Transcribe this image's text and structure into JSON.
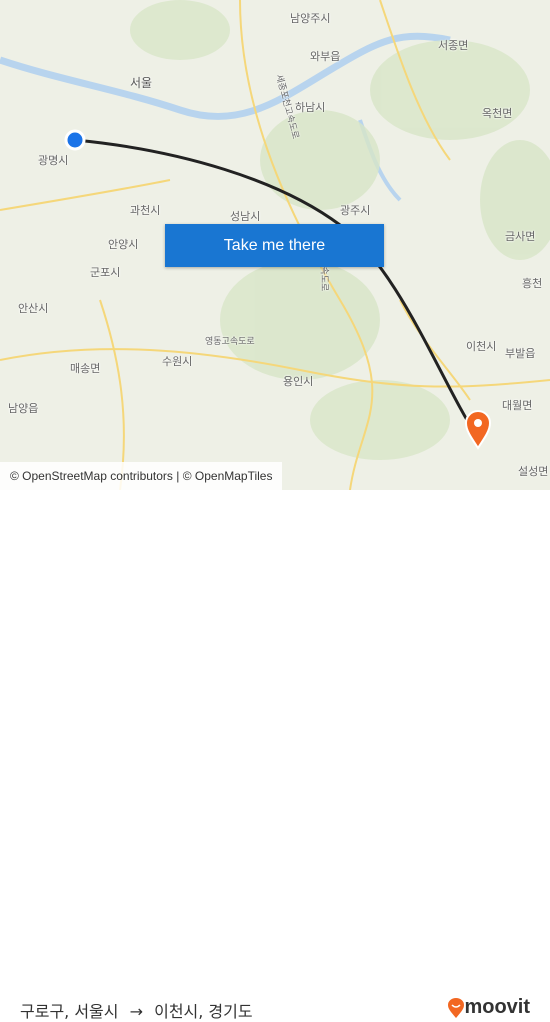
{
  "map": {
    "labels": [
      "남양주시",
      "와부읍",
      "서종면",
      "서울",
      "하남시",
      "옥천면",
      "광명시",
      "과천시",
      "성남시",
      "광주시",
      "금사면",
      "안양시",
      "군포시",
      "안산시",
      "흥천",
      "수원시",
      "부발읍",
      "매송면",
      "용인시",
      "대월면",
      "남양읍",
      "이천시",
      "설성면",
      "영동고속도로",
      "세종포천고속도로",
      "중부고속도로"
    ],
    "route_color": "#222222",
    "origin_color": "#1a73e8",
    "destination_color": "#f26722"
  },
  "cta": {
    "label": "Take me there"
  },
  "attribution": "© OpenStreetMap contributors | © OpenMapTiles",
  "footer": {
    "origin": "구로구, 서울시",
    "arrow": "→",
    "destination": "이천시, 경기도",
    "brand": "moovit",
    "brand_color": "#f26722"
  }
}
